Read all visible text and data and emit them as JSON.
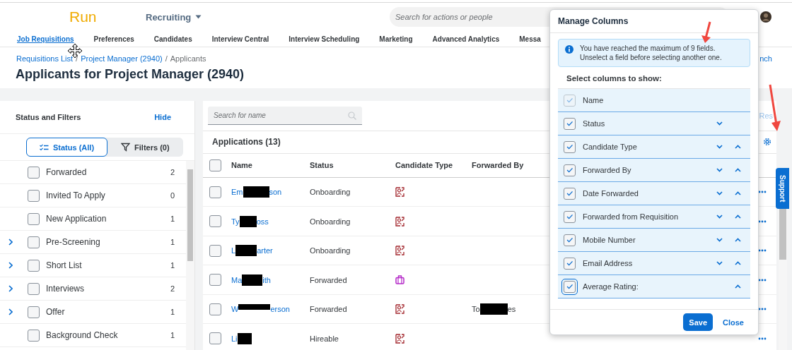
{
  "header": {
    "logo": "Run",
    "module": "Recruiting",
    "search": {
      "placeholder": "Search for actions or people"
    },
    "nav": [
      {
        "label": "Job Requisitions",
        "selected": true
      },
      {
        "label": "Preferences",
        "selected": false
      },
      {
        "label": "Candidates",
        "selected": false
      },
      {
        "label": "Interview Central",
        "selected": false
      },
      {
        "label": "Interview Scheduling",
        "selected": false
      },
      {
        "label": "Marketing",
        "selected": false
      },
      {
        "label": "Advanced Analytics",
        "selected": false
      },
      {
        "label": "Messa",
        "selected": false
      }
    ]
  },
  "breadcrumb": [
    {
      "text": "Requisitions List",
      "kind": "link"
    },
    {
      "text": "/",
      "kind": "separator"
    },
    {
      "text": "Project Manager (2940)",
      "kind": "link"
    },
    {
      "text": "/",
      "kind": "separator"
    },
    {
      "text": "Applicants",
      "kind": "current"
    }
  ],
  "breadcrumb_right": "nch",
  "title": "Applicants for Project Manager (2940)",
  "filters_panel": {
    "title": "Status and Filters",
    "hide": "Hide",
    "toggles": [
      {
        "label": "Status (All)",
        "selected": true,
        "kind": "status"
      },
      {
        "label": "Filters (0)",
        "selected": false,
        "kind": "filter"
      }
    ],
    "statuses": [
      {
        "label": "Forwarded",
        "count": "2",
        "expandable": false,
        "checked": false
      },
      {
        "label": "Invited To Apply",
        "count": "0",
        "expandable": false,
        "checked": false
      },
      {
        "label": "New Application",
        "count": "1",
        "expandable": false,
        "checked": false
      },
      {
        "label": "Pre-Screening",
        "count": "1",
        "expandable": true,
        "checked": false
      },
      {
        "label": "Short List",
        "count": "1",
        "expandable": true,
        "checked": false
      },
      {
        "label": "Interviews",
        "count": "2",
        "expandable": true,
        "checked": false
      },
      {
        "label": "Offer",
        "count": "1",
        "expandable": true,
        "checked": false
      },
      {
        "label": "Background Check",
        "count": "1",
        "expandable": false,
        "checked": false
      }
    ]
  },
  "applications": {
    "search": {
      "placeholder": "Search for name"
    },
    "reset": "Res",
    "title": "Applications (13)",
    "select_all_checked": false,
    "columns": [
      "Name",
      "Status",
      "Candidate Type",
      "Forwarded By"
    ],
    "rows": [
      {
        "name_start": "Em",
        "name_end": "son",
        "status": "Onboarding",
        "kind": "person",
        "checked": false
      },
      {
        "name_start": "Ty",
        "name_end": "oss",
        "status": "Onboarding",
        "kind": "person",
        "checked": false
      },
      {
        "name_start": "L",
        "name_end": "arter",
        "status": "Onboarding",
        "kind": "person",
        "checked": false
      },
      {
        "name_start": "Ma",
        "name_end": "ith",
        "status": "Forwarded",
        "kind": "briefcase",
        "checked": false
      },
      {
        "name_start": "W",
        "name_end": "erson",
        "status": "Forwarded",
        "kind": "person",
        "forwarded_by_start": "To",
        "forwarded_by_end": "es",
        "checked": false
      },
      {
        "name_start": "Li",
        "status": "Hireable",
        "kind": "person",
        "checked": false
      }
    ]
  },
  "support": "Support",
  "manage_columns": {
    "title": "Manage Columns",
    "info": "You have reached the maximum of 9 fields. Unselect a field before selecting another one.",
    "subtitle": "Select columns to show:",
    "columns": [
      {
        "label": "Name",
        "checked": true,
        "disabled": true,
        "down": false,
        "up": false,
        "focused": false
      },
      {
        "label": "Status",
        "checked": true,
        "disabled": false,
        "down": true,
        "up": false,
        "focused": false
      },
      {
        "label": "Candidate Type",
        "checked": true,
        "disabled": false,
        "down": true,
        "up": true,
        "focused": false
      },
      {
        "label": "Forwarded By",
        "checked": true,
        "disabled": false,
        "down": true,
        "up": true,
        "focused": false
      },
      {
        "label": "Date Forwarded",
        "checked": true,
        "disabled": false,
        "down": true,
        "up": true,
        "focused": false
      },
      {
        "label": "Forwarded from Requisition",
        "checked": true,
        "disabled": false,
        "down": true,
        "up": true,
        "focused": false
      },
      {
        "label": "Mobile Number",
        "checked": true,
        "disabled": false,
        "down": true,
        "up": true,
        "focused": false
      },
      {
        "label": "Email Address",
        "checked": true,
        "disabled": false,
        "down": true,
        "up": true,
        "focused": false
      },
      {
        "label": "Average Rating:",
        "checked": true,
        "disabled": false,
        "down": false,
        "up": true,
        "focused": true
      }
    ],
    "buttons": [
      {
        "label": "Save",
        "kind": "primary"
      },
      {
        "label": "Close",
        "kind": "link"
      }
    ]
  }
}
